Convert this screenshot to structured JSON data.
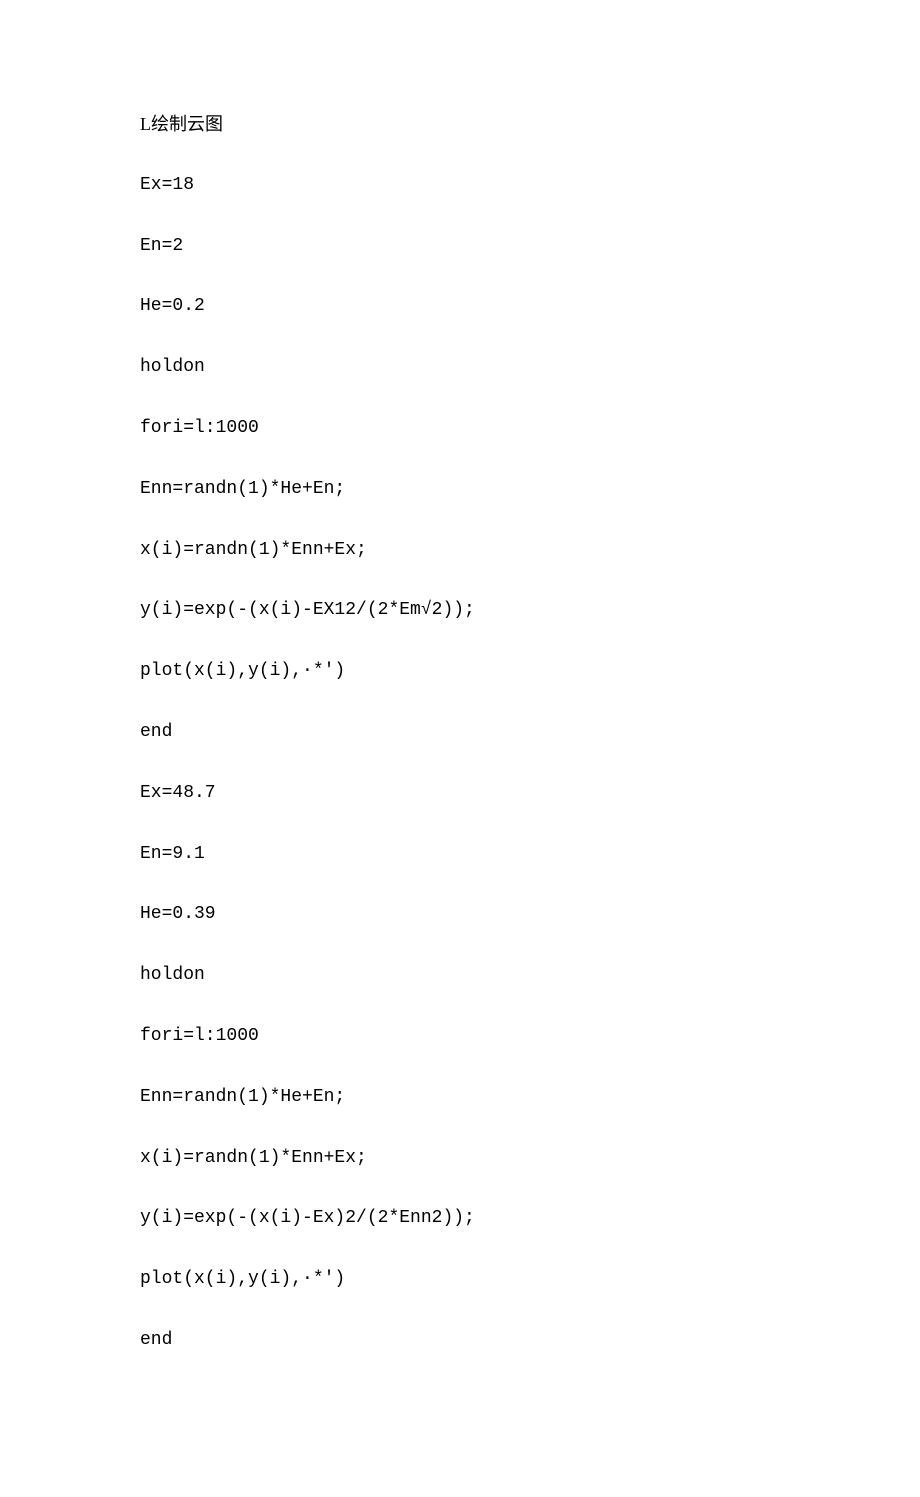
{
  "lines": [
    {
      "text": "L绘制云图",
      "type": "mixed"
    },
    {
      "text": "Ex=18",
      "type": "code"
    },
    {
      "text": "En=2",
      "type": "code"
    },
    {
      "text": "He=0.2",
      "type": "code"
    },
    {
      "text": "holdon",
      "type": "code"
    },
    {
      "text": "fori=l:1000",
      "type": "code"
    },
    {
      "text": "Enn=randn(1)*He+En;",
      "type": "code"
    },
    {
      "text": "x(i)=randn(1)*Enn+Ex;",
      "type": "code"
    },
    {
      "text": "y(i)=exp(-(x(i)-EX12/(2*Em√2));",
      "type": "code"
    },
    {
      "text": "plot(x(i),y(i),·*')",
      "type": "code"
    },
    {
      "text": "end",
      "type": "code"
    },
    {
      "text": "Ex=48.7",
      "type": "code"
    },
    {
      "text": "En=9.1",
      "type": "code"
    },
    {
      "text": "He=0.39",
      "type": "code"
    },
    {
      "text": "holdon",
      "type": "code"
    },
    {
      "text": "fori=l:1000",
      "type": "code"
    },
    {
      "text": "Enn=randn(1)*He+En;",
      "type": "code"
    },
    {
      "text": "x(i)=randn(1)*Enn+Ex;",
      "type": "code"
    },
    {
      "text": "y(i)=exp(-(x(i)-Ex)2/(2*Enn2));",
      "type": "code"
    },
    {
      "text": "plot(x(i),y(i),·*')",
      "type": "code"
    },
    {
      "text": "end",
      "type": "code"
    }
  ]
}
